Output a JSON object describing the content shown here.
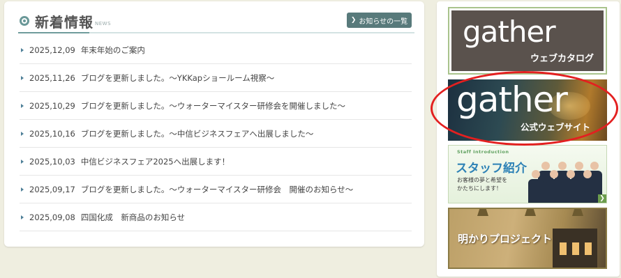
{
  "news": {
    "title": "新着情報",
    "subtitle": "NEWS",
    "all_button": "お知らせの一覧",
    "items": [
      {
        "date": "2025,12,09",
        "text": "年末年始のご案内"
      },
      {
        "date": "2025,11,26",
        "text": "ブログを更新しました。～YKKapショールーム視察～"
      },
      {
        "date": "2025,10,29",
        "text": "ブログを更新しました。～ウォーターマイスター研修会を開催しました～"
      },
      {
        "date": "2025,10,16",
        "text": "ブログを更新しました。～中信ビジネスフェアへ出展しました～"
      },
      {
        "date": "2025,10,03",
        "text": "中信ビジネスフェア2025へ出展します！"
      },
      {
        "date": "2025,09,17",
        "text": "ブログを更新しました。～ウォーターマイスター研修会　開催のお知らせ～"
      },
      {
        "date": "2025,09,08",
        "text": "四国化成　新商品のお知らせ"
      }
    ]
  },
  "sidebar": {
    "catalog": {
      "logo": "gather",
      "caption": "ウェブカタログ"
    },
    "official": {
      "logo": "gather",
      "caption": "公式ウェブサイト"
    },
    "staff": {
      "en": "Staff Introduction",
      "title": "スタッフ紹介",
      "sub": "お客様の夢と希望を\nかたちにします！"
    },
    "light": {
      "title": "明かりプロジェクト"
    }
  },
  "colors": {
    "background": "#efeee0",
    "accent": "#587a7b",
    "highlight": "#e32020"
  }
}
